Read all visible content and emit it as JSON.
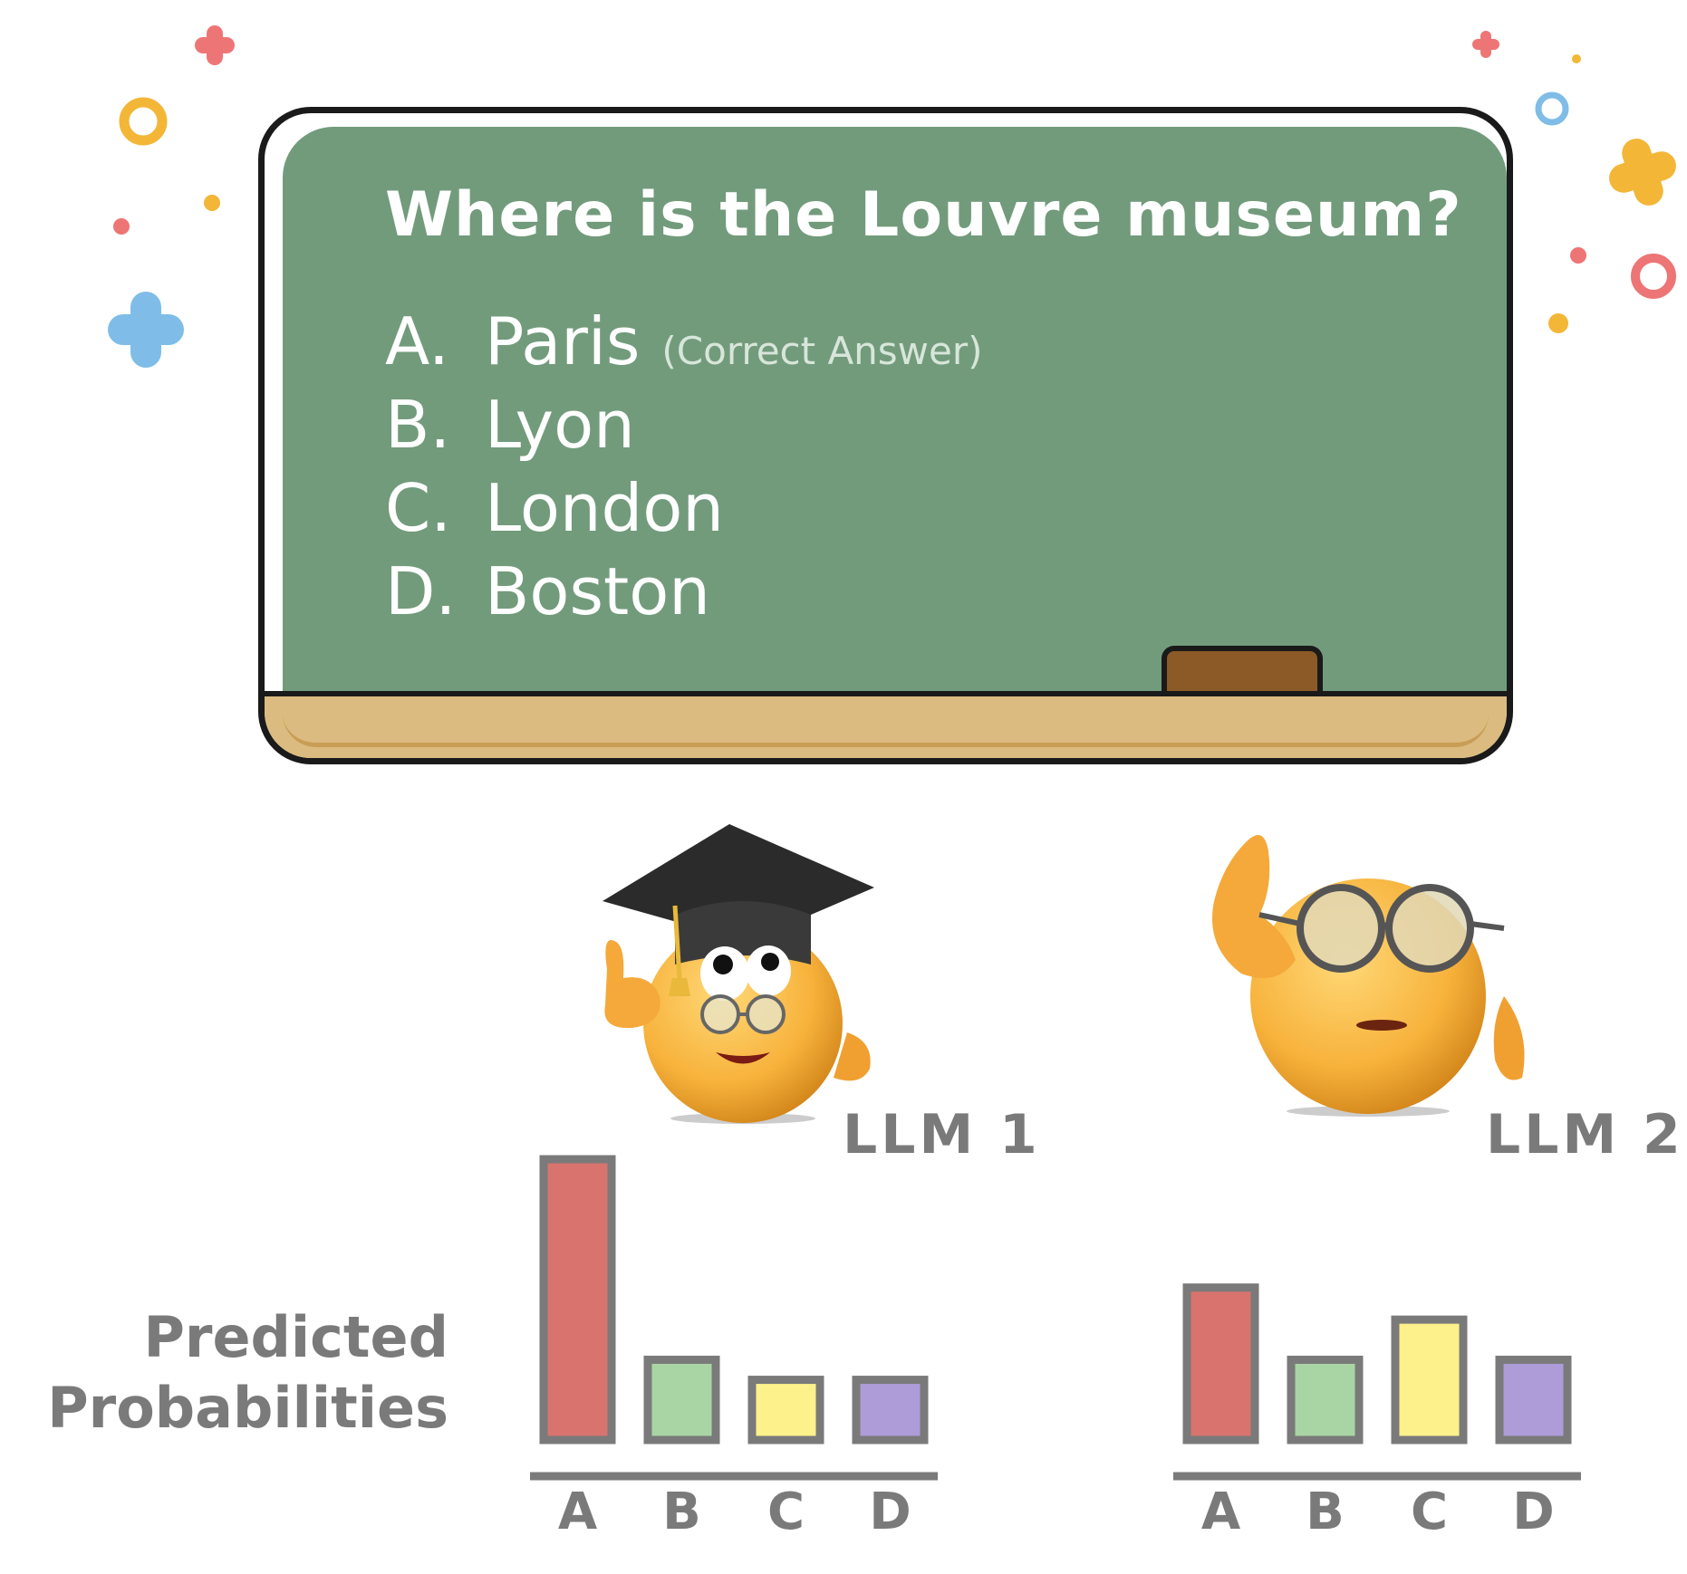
{
  "blackboard": {
    "question": "Where is the Louvre museum?",
    "options": [
      {
        "letter": "A.",
        "text": "Paris",
        "note": "(Correct Answer)"
      },
      {
        "letter": "B.",
        "text": "Lyon",
        "note": ""
      },
      {
        "letter": "C.",
        "text": "London",
        "note": ""
      },
      {
        "letter": "D.",
        "text": "Boston",
        "note": ""
      }
    ]
  },
  "models": [
    {
      "label": "LLM 1",
      "icon": "graduate-emoji-icon"
    },
    {
      "label": "LLM 2",
      "icon": "confused-emoji-icon"
    }
  ],
  "axis_title_line1": "Predicted",
  "axis_title_line2": "Probabilities",
  "colors": {
    "A": "#d8736e",
    "B": "#a9d5a4",
    "C": "#fdf18c",
    "D": "#ad9cd8",
    "bar_border": "#7a7a7a",
    "board_green": "#729b7c",
    "ledge": "#dbbb80"
  },
  "chart_data": [
    {
      "type": "bar",
      "model": "LLM 1",
      "categories": [
        "A",
        "B",
        "C",
        "D"
      ],
      "values": [
        0.7,
        0.2,
        0.15,
        0.15
      ]
    },
    {
      "type": "bar",
      "model": "LLM 2",
      "categories": [
        "A",
        "B",
        "C",
        "D"
      ],
      "values": [
        0.38,
        0.2,
        0.3,
        0.2
      ]
    }
  ]
}
